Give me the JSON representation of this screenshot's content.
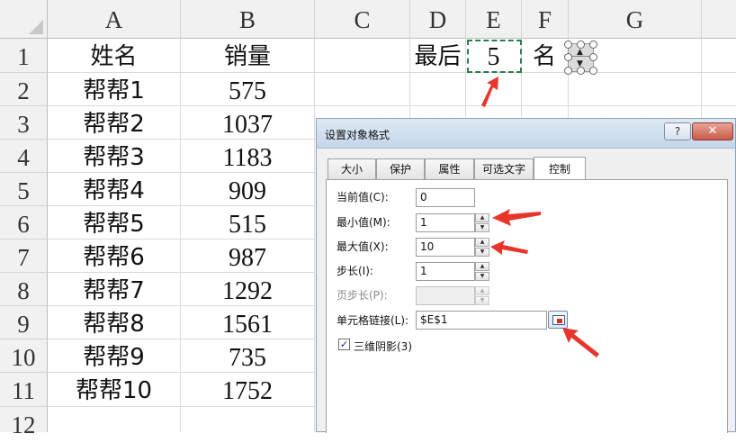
{
  "sheet": {
    "columns": [
      "A",
      "B",
      "C",
      "D",
      "E",
      "F",
      "G"
    ],
    "rows": [
      "1",
      "2",
      "3",
      "4",
      "5",
      "6",
      "7",
      "8",
      "9",
      "10",
      "11",
      "12"
    ],
    "headers": {
      "name": "姓名",
      "sales": "销量"
    },
    "records": [
      {
        "name": "帮帮1",
        "sales": "575"
      },
      {
        "name": "帮帮2",
        "sales": "1037"
      },
      {
        "name": "帮帮3",
        "sales": "1183"
      },
      {
        "name": "帮帮4",
        "sales": "909"
      },
      {
        "name": "帮帮5",
        "sales": "515"
      },
      {
        "name": "帮帮6",
        "sales": "987"
      },
      {
        "name": "帮帮7",
        "sales": "1292"
      },
      {
        "name": "帮帮8",
        "sales": "1561"
      },
      {
        "name": "帮帮9",
        "sales": "735"
      },
      {
        "name": "帮帮10",
        "sales": "1752"
      }
    ],
    "d1": "最后",
    "e1": "5",
    "f1": "名"
  },
  "dialog": {
    "title": "设置对象格式",
    "help_label": "?",
    "close_label": "✕",
    "tabs": [
      "大小",
      "保护",
      "属性",
      "可选文字",
      "控制"
    ],
    "active_tab": "控制",
    "fields": {
      "current_value": {
        "label": "当前值(C):",
        "value": "0"
      },
      "min_value": {
        "label": "最小值(M):",
        "value": "1"
      },
      "max_value": {
        "label": "最大值(X):",
        "value": "10"
      },
      "step": {
        "label": "步长(I):",
        "value": "1"
      },
      "page_step": {
        "label": "页步长(P):",
        "value": ""
      },
      "cell_link": {
        "label": "单元格链接(L):",
        "value": "$E$1"
      }
    },
    "shading": {
      "label": "三维阴影(3)",
      "checked": true
    }
  },
  "icons": {
    "spin_up": "▲",
    "spin_down": "▼",
    "check": "✓",
    "cell_ref_button": "range-selector-icon"
  },
  "colors": {
    "annotation_arrow": "#e8352a",
    "selection_border": "#2e7d4f",
    "header_bg": "#f1f1f1"
  }
}
